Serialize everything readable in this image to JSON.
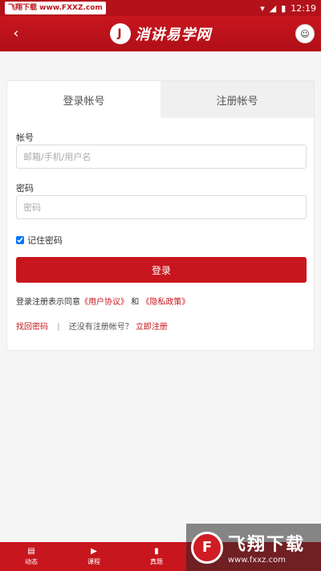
{
  "status_bar": {
    "watermark": "飞翔下载 www.FXXZ.com",
    "time": "12:19"
  },
  "app_bar": {
    "back_icon": "‹",
    "brand_mark": "J",
    "brand_name": "消讲易学网",
    "avatar_icon": "头像"
  },
  "tabs": [
    {
      "label": "登录帐号",
      "active": true
    },
    {
      "label": "注册帐号",
      "active": false
    }
  ],
  "form": {
    "account_label": "帐号",
    "account_placeholder": "邮箱/手机/用户名",
    "account_value": "",
    "password_label": "密码",
    "password_placeholder": "密码",
    "password_value": "",
    "remember_label": "记住密码",
    "remember_checked": true,
    "login_button": "登录"
  },
  "agreement": {
    "prefix": "登录注册表示同意",
    "user_agreement": "《用户协议》",
    "and": "和",
    "privacy_policy": "《隐私政策》"
  },
  "bottom_links": {
    "forgot_password": "找回密码",
    "separator": "|",
    "no_account": "还没有注册帐号？",
    "register_now": "立即注册"
  },
  "tab_bar": [
    {
      "label": "动态",
      "icon": "news-icon"
    },
    {
      "label": "课程",
      "icon": "video-icon"
    },
    {
      "label": "真题",
      "icon": "book-icon"
    }
  ],
  "watermark_bottom": {
    "logo": "F",
    "title": "飞翔下载",
    "url": "www.fxxz.com"
  },
  "colors": {
    "brand_red": "#c8161e",
    "status_bar": "#b3121b"
  }
}
